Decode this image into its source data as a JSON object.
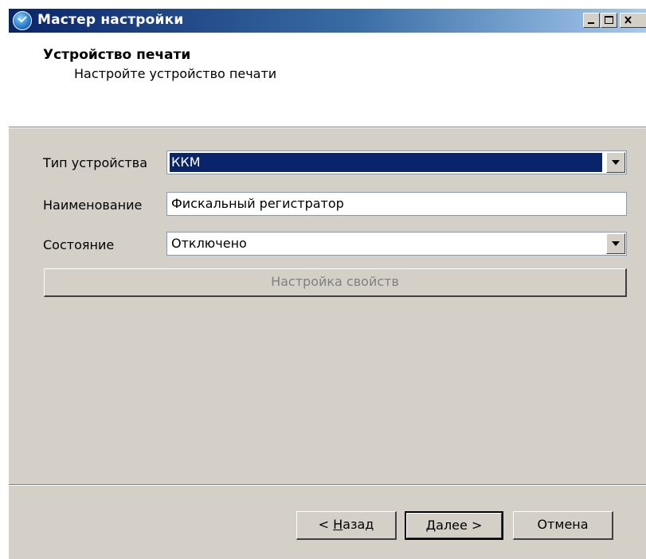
{
  "window": {
    "title": "Мастер настройки"
  },
  "header": {
    "title": "Устройство печати",
    "subtitle": "Настройте устройство печати"
  },
  "form": {
    "device_type": {
      "label": "Тип устройства",
      "value": "ККМ"
    },
    "name": {
      "label": "Наименование",
      "value": "Фискальный регистратор"
    },
    "state": {
      "label": "Состояние",
      "value": "Отключено"
    },
    "properties_button": "Настройка свойств"
  },
  "footer": {
    "back_prefix": "< ",
    "back_mnemonic": "Н",
    "back_rest": "азад",
    "next_mnemonic": "Д",
    "next_rest": "алее >",
    "cancel": "Отмена"
  },
  "colors": {
    "titlebar_start": "#0a246a",
    "titlebar_end": "#a6caf0",
    "face": "#d4d0c8",
    "selection": "#0a246a"
  },
  "icons": {
    "app": "wizard-globe-icon",
    "minimize": "minimize-icon",
    "maximize": "maximize-icon",
    "close": "close-icon",
    "dropdown": "chevron-down-icon"
  }
}
